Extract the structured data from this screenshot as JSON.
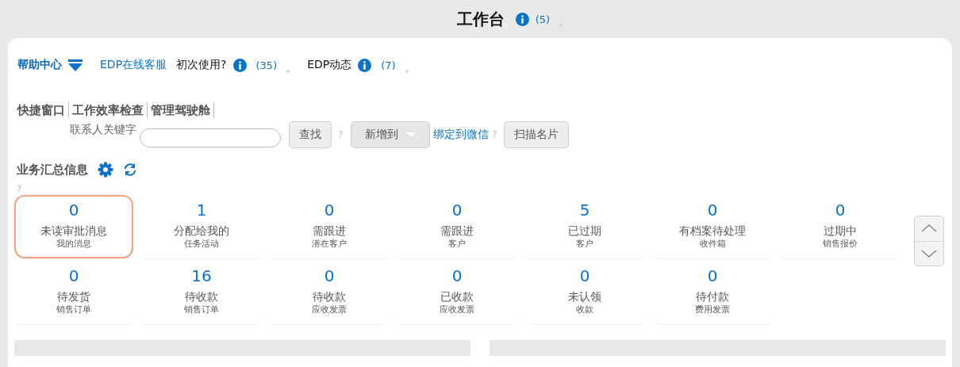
{
  "page": {
    "title": "工作台",
    "info_count": "(5)"
  },
  "help_bar": {
    "help_center": "帮助中心",
    "links": [
      {
        "kind": "link",
        "label": "EDP在线客服"
      },
      {
        "kind": "info",
        "label": "初次使用?",
        "count": "(35)"
      },
      {
        "kind": "info",
        "label": "EDP动态",
        "count": "(7)"
      }
    ]
  },
  "tabs": [
    {
      "label": "快捷窗口"
    },
    {
      "label": "工作效率检查"
    },
    {
      "label": "管理驾驶舱"
    }
  ],
  "search": {
    "label": "联系人关键字",
    "button": "查找",
    "help": "?",
    "add_button": "新增到",
    "link": "绑定到微信",
    "link_help": "?",
    "scan_button": "扫描名片"
  },
  "summary": {
    "title": "业务汇总信息",
    "help": "?",
    "tiles": [
      {
        "value": "0",
        "label": "未读审批消息",
        "sub": "我的消息",
        "selected": true
      },
      {
        "value": "1",
        "label": "分配给我的",
        "sub": "任务活动",
        "selected": false
      },
      {
        "value": "0",
        "label": "需跟进",
        "sub": "潜在客户",
        "selected": false
      },
      {
        "value": "0",
        "label": "需跟进",
        "sub": "客户",
        "selected": false
      },
      {
        "value": "5",
        "label": "已过期",
        "sub": "客户",
        "selected": false
      },
      {
        "value": "0",
        "label": "有档案待处理",
        "sub": "收件箱",
        "selected": false
      },
      {
        "value": "0",
        "label": "过期中",
        "sub": "销售报价",
        "selected": false
      },
      {
        "value": "0",
        "label": "待发货",
        "sub": "销售订单",
        "selected": false
      },
      {
        "value": "16",
        "label": "待收款",
        "sub": "销售订单",
        "selected": false
      },
      {
        "value": "0",
        "label": "待收款",
        "sub": "应收发票",
        "selected": false
      },
      {
        "value": "0",
        "label": "已收款",
        "sub": "应收发票",
        "selected": false
      },
      {
        "value": "0",
        "label": "未认领",
        "sub": "收款",
        "selected": false
      },
      {
        "value": "0",
        "label": "待付款",
        "sub": "费用发票",
        "selected": false
      }
    ]
  }
}
